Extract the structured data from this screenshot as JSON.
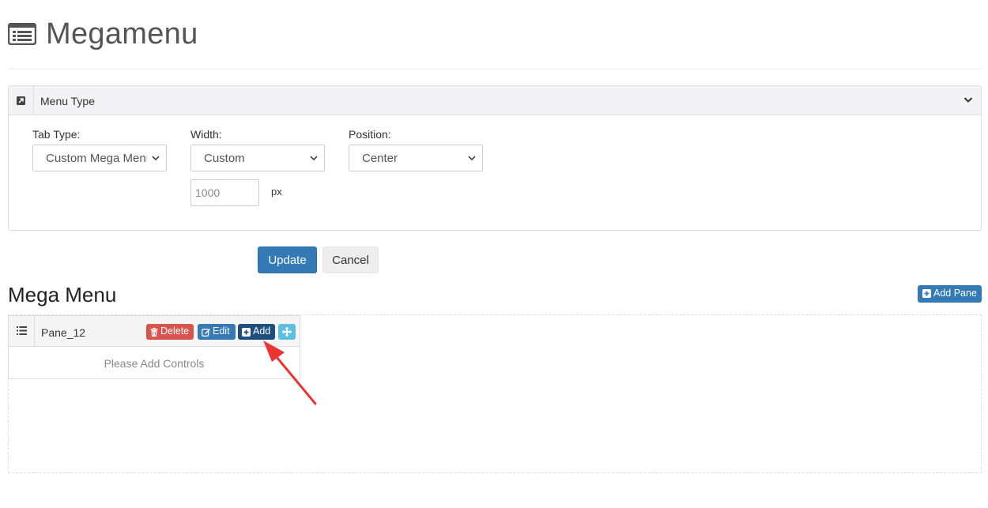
{
  "header": {
    "title": "Megamenu",
    "icon": "list-alt-icon"
  },
  "menu_type_panel": {
    "title": "Menu Type",
    "toggle_icon": "collapse-icon",
    "chevron_icon": "chevron-down-icon",
    "tab_type": {
      "label": "Tab Type:",
      "value": "Custom Mega Menu"
    },
    "width": {
      "label": "Width:",
      "value": "Custom",
      "px_value": "1000",
      "unit": "px"
    },
    "position": {
      "label": "Position:",
      "value": "Center"
    }
  },
  "actions": {
    "update_label": "Update",
    "cancel_label": "Cancel"
  },
  "mega_menu": {
    "title": "Mega Menu",
    "add_pane_label": "Add Pane",
    "panes": [
      {
        "title": "Pane_12",
        "delete_label": "Delete",
        "edit_label": "Edit",
        "add_label": "Add",
        "empty_text": "Please Add Controls"
      }
    ]
  },
  "colors": {
    "primary": "#337ab7",
    "danger": "#d9534f",
    "dark_primary": "#1f4f7f",
    "info": "#5bc0de",
    "annotation": "#ee3333"
  }
}
